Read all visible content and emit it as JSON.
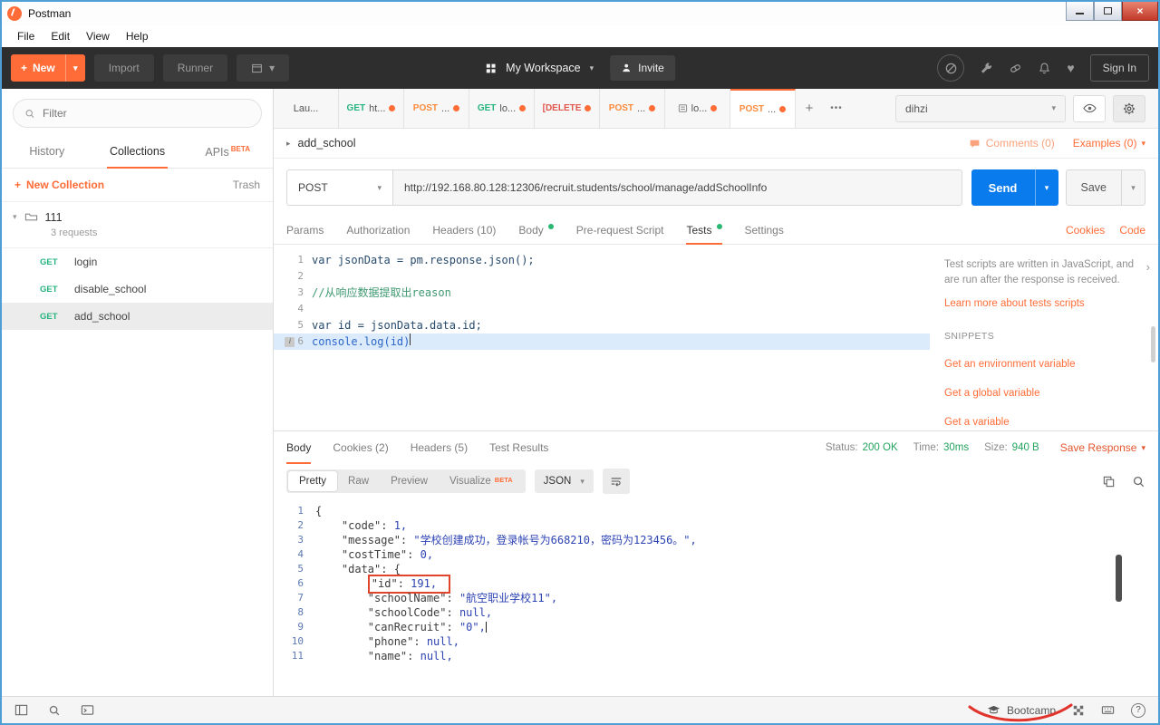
{
  "window": {
    "title": "Postman",
    "menu": [
      "File",
      "Edit",
      "View",
      "Help"
    ]
  },
  "icons": {
    "caret_down": "▾",
    "caret_right": "▸",
    "plus": "+",
    "more": "•••",
    "close": "×",
    "heart": "♥",
    "info": "i",
    "help": "?",
    "panel_chevron": "›"
  },
  "header": {
    "new_label": "New",
    "import_label": "Import",
    "runner_label": "Runner",
    "workspace_label": "My Workspace",
    "invite_label": "Invite",
    "signin_label": "Sign In"
  },
  "sidebar": {
    "filter_placeholder": "Filter",
    "tabs": [
      {
        "label": "History"
      },
      {
        "label": "Collections"
      },
      {
        "label": "APIs",
        "badge": "BETA"
      }
    ],
    "new_collection_label": "New Collection",
    "trash_label": "Trash",
    "collection": {
      "name": "111",
      "meta": "3 requests"
    },
    "requests": [
      {
        "method": "GET",
        "name": "login"
      },
      {
        "method": "GET",
        "name": "disable_school"
      },
      {
        "method": "GET",
        "name": "add_school"
      }
    ]
  },
  "tabstrip": {
    "tabs": [
      {
        "method": "",
        "label": "Lau..."
      },
      {
        "method": "GET",
        "label": "ht..."
      },
      {
        "method": "POST",
        "label": "..."
      },
      {
        "method": "GET",
        "label": "lo..."
      },
      {
        "method": "[DELETE",
        "label": ""
      },
      {
        "method": "POST",
        "label": "..."
      },
      {
        "method": "",
        "label": "lo..."
      },
      {
        "method": "POST",
        "label": "..."
      }
    ],
    "environment": "dihzi"
  },
  "request": {
    "name": "add_school",
    "comments_label": "Comments (0)",
    "examples_label": "Examples (0)",
    "method": "POST",
    "url": "http://192.168.80.128:12306/recruit.students/school/manage/addSchoolInfo",
    "send_label": "Send",
    "save_label": "Save",
    "tabs": [
      {
        "label": "Params"
      },
      {
        "label": "Authorization"
      },
      {
        "label": "Headers (10)"
      },
      {
        "label": "Body"
      },
      {
        "label": "Pre-request Script"
      },
      {
        "label": "Tests"
      },
      {
        "label": "Settings"
      }
    ],
    "cookies_link": "Cookies",
    "code_link": "Code"
  },
  "tests_editor": {
    "lines": [
      {
        "num": "1",
        "code": "var jsonData = pm.response.json();"
      },
      {
        "num": "2",
        "code": ""
      },
      {
        "num": "3",
        "code": "//从响应数据提取出reason"
      },
      {
        "num": "4",
        "code": ""
      },
      {
        "num": "5",
        "code": "var id = jsonData.data.id;"
      },
      {
        "num": "6",
        "code": "console.log(id)"
      }
    ]
  },
  "tests_help": {
    "description": "Test scripts are written in JavaScript, and are run after the response is received.",
    "learn_link": "Learn more about tests scripts",
    "snippets_title": "SNIPPETS",
    "snippets": [
      {
        "label": "Get an environment variable"
      },
      {
        "label": "Get a global variable"
      },
      {
        "label": "Get a variable"
      }
    ]
  },
  "response": {
    "tabs": [
      {
        "label": "Body"
      },
      {
        "label": "Cookies (2)"
      },
      {
        "label": "Headers (5)"
      },
      {
        "label": "Test Results"
      }
    ],
    "status_label": "Status:",
    "status_value": "200 OK",
    "time_label": "Time:",
    "time_value": "30ms",
    "size_label": "Size:",
    "size_value": "940 B",
    "save_response_label": "Save Response",
    "view_tabs": [
      {
        "label": "Pretty"
      },
      {
        "label": "Raw"
      },
      {
        "label": "Preview"
      },
      {
        "label": "Visualize",
        "badge": "BETA"
      }
    ],
    "format": "JSON",
    "lines": [
      {
        "num": "1",
        "pre": "{",
        "key": "",
        "val": "",
        "tail": ""
      },
      {
        "num": "2",
        "pre": "    ",
        "key": "\"code\": ",
        "val": "1,",
        "tail": ""
      },
      {
        "num": "3",
        "pre": "    ",
        "key": "\"message\": ",
        "val": "\"学校创建成功，登录帐号为668210，密码为123456。\",",
        "tail": ""
      },
      {
        "num": "4",
        "pre": "    ",
        "key": "\"costTime\": ",
        "val": "0,",
        "tail": ""
      },
      {
        "num": "5",
        "pre": "    ",
        "key": "\"data\": ",
        "val": "",
        "tail": "{"
      },
      {
        "num": "6",
        "pre": "        ",
        "key": "\"id\": ",
        "val": "191,",
        "tail": ""
      },
      {
        "num": "7",
        "pre": "        ",
        "key": "\"schoolName\": ",
        "val": "\"航空职业学校11\",",
        "tail": ""
      },
      {
        "num": "8",
        "pre": "        ",
        "key": "\"schoolCode\": ",
        "val": "null,",
        "tail": ""
      },
      {
        "num": "9",
        "pre": "        ",
        "key": "\"canRecruit\": ",
        "val": "\"0\",",
        "tail": ""
      },
      {
        "num": "10",
        "pre": "        ",
        "key": "\"phone\": ",
        "val": "null,",
        "tail": ""
      },
      {
        "num": "11",
        "pre": "        ",
        "key": "\"name\": ",
        "val": "null,",
        "tail": ""
      }
    ]
  },
  "statusbar": {
    "bootcamp_label": "Bootcamp"
  },
  "colors": {
    "accent_orange": "#ff6c37",
    "method_get": "#26b47f",
    "method_post": "#fb8b3c",
    "method_delete": "#e0564c",
    "status_green": "#23a45d",
    "send_blue": "#097bed",
    "annotation_red": "#e0442c"
  }
}
